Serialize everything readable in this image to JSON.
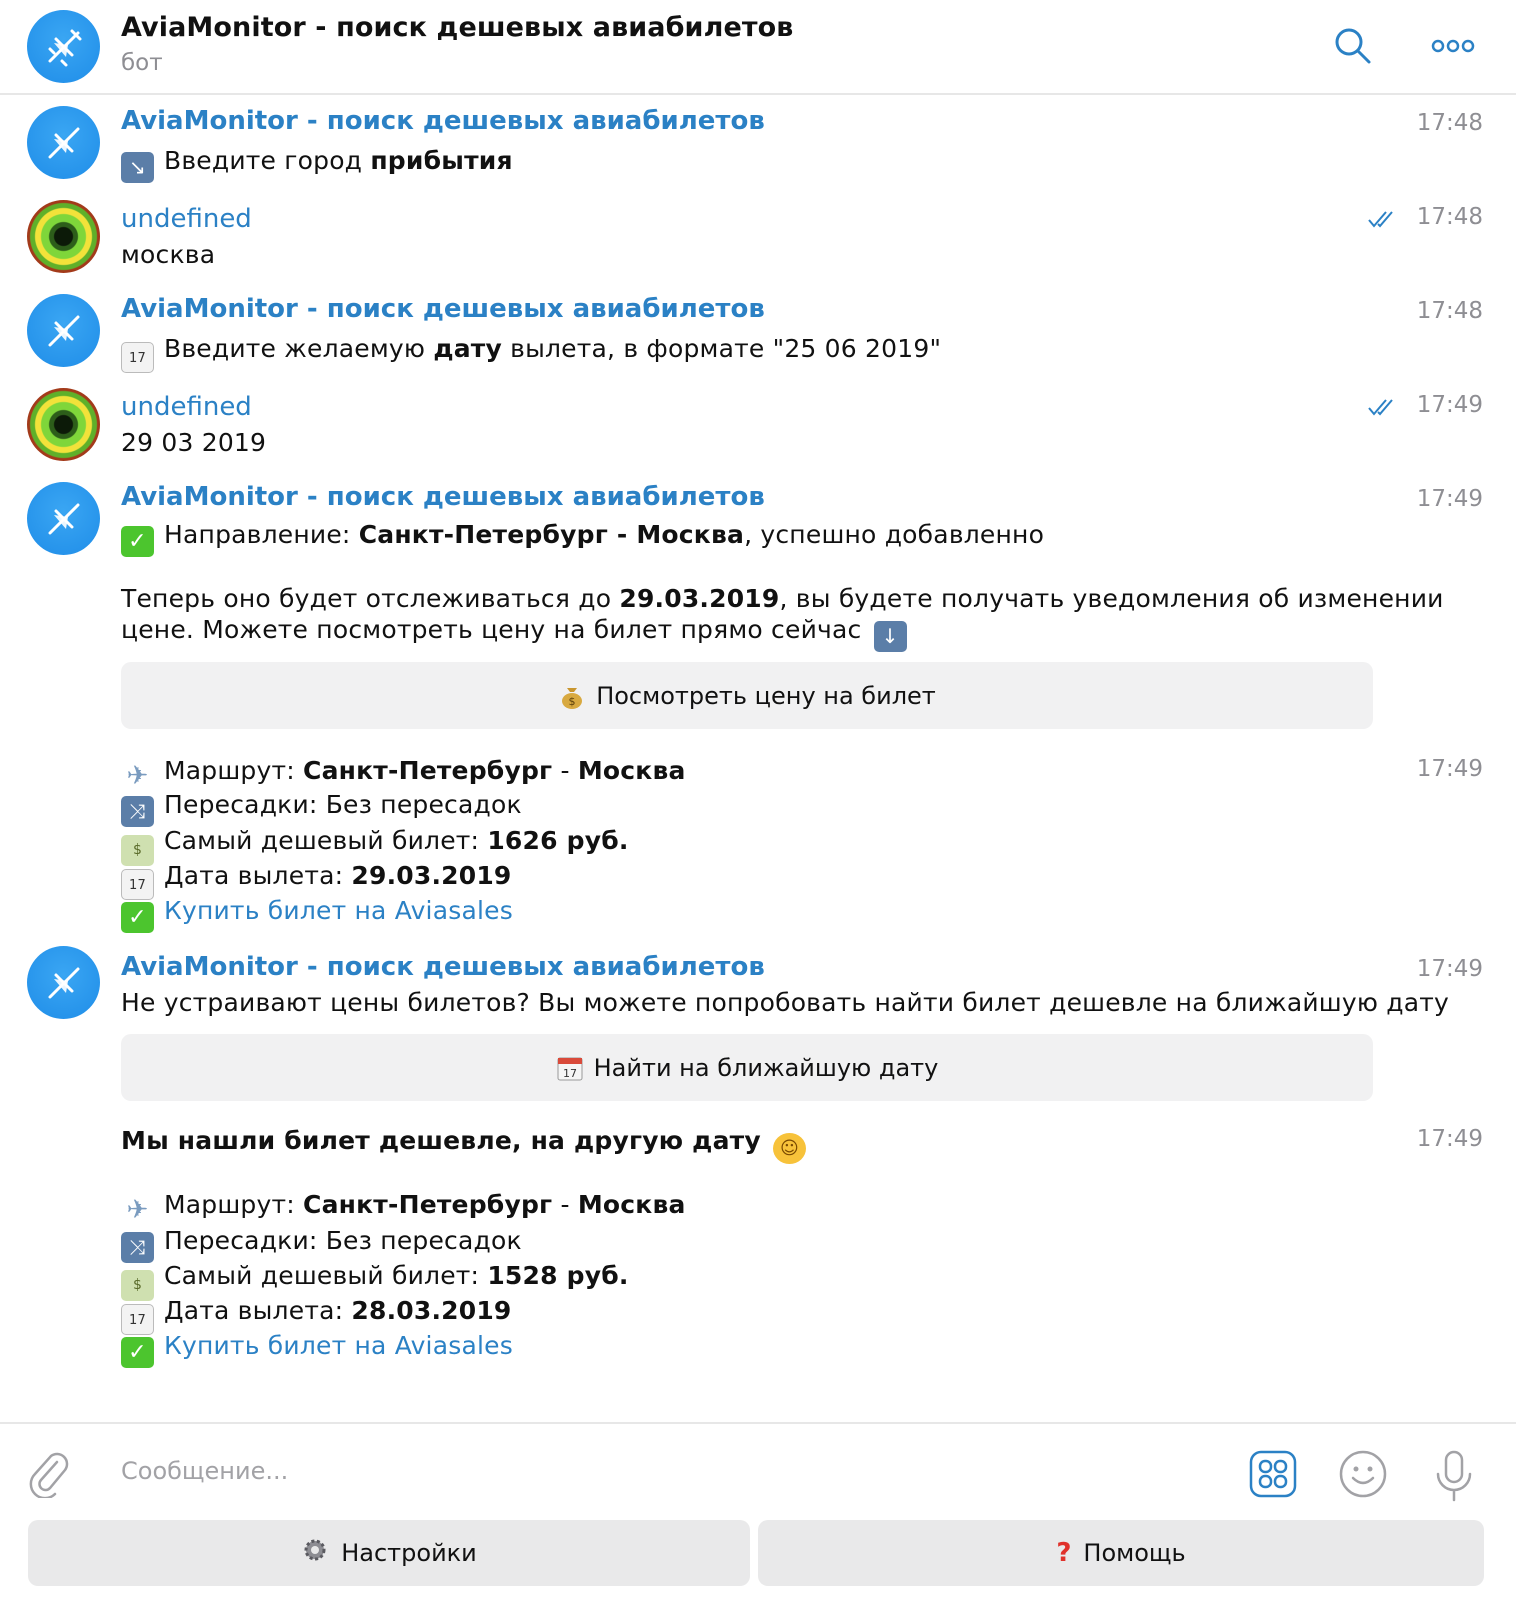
{
  "header": {
    "title": "AviaMonitor - поиск дешевых авиабилетов",
    "subtitle": "бот"
  },
  "messages": [
    {
      "sender": "AviaMonitor - поиск дешевых авиабилетов",
      "time": "17:48",
      "text_pre": "Введите город ",
      "text_bold": "прибытия"
    },
    {
      "sender": "undefined",
      "time": "17:48",
      "text": "москва"
    },
    {
      "sender": "AviaMonitor - поиск дешевых авиабилетов",
      "time": "17:48",
      "text_pre": "Введите желаемую ",
      "text_bold": "дату",
      "text_post": " вылета, в формате \"25 06 2019\""
    },
    {
      "sender": "undefined",
      "time": "17:49",
      "text": "29 03 2019"
    },
    {
      "sender": "AviaMonitor - поиск дешевых авиабилетов",
      "time": "17:49",
      "line1_pre": "Направление: ",
      "line1_bold": "Санкт-Петербург - Москва",
      "line1_post": ", успешно добавленно",
      "line2_pre": "Теперь оно будет отслеживаться до ",
      "line2_bold": "29.03.2019",
      "line2_post": ", вы будете получать уведомления об изменении",
      "line3": "цене. Можете посмотреть цену на билет прямо сейчас",
      "button": "Посмотреть цену на билет"
    },
    {
      "time": "17:49",
      "route_label": "Маршрут: ",
      "route_value": "Санкт-Петербург",
      "route_sep": " - ",
      "route_value2": "Москва",
      "transfers": "Пересадки: Без пересадок",
      "price_label": "Самый дешевый билет: ",
      "price_value": "1626 руб.",
      "date_label": "Дата вылета: ",
      "date_value": "29.03.2019",
      "buy_link": "Купить билет на Aviasales"
    },
    {
      "sender": "AviaMonitor - поиск дешевых авиабилетов",
      "time": "17:49",
      "text": "Не устраивают цены билетов? Вы можете попробовать найти билет дешевле на ближайшую дату",
      "button": "Найти на ближайшую дату"
    },
    {
      "time": "17:49",
      "headline": "Мы нашли билет дешевле, на другую дату",
      "route_label": "Маршрут: ",
      "route_value": "Санкт-Петербург",
      "route_sep": " - ",
      "route_value2": "Москва",
      "transfers": "Пересадки: Без пересадок",
      "price_label": "Самый дешевый билет: ",
      "price_value": "1528 руб.",
      "date_label": "Дата вылета: ",
      "date_value": "28.03.2019",
      "buy_link": "Купить билет на Aviasales"
    }
  ],
  "composer": {
    "placeholder": "Сообщение..."
  },
  "keyboard": {
    "settings": "Настройки",
    "help": "Помощь"
  },
  "colors": {
    "accent": "#2b81c5",
    "muted": "#8e8e93",
    "button_bg": "#f1f1f2"
  }
}
